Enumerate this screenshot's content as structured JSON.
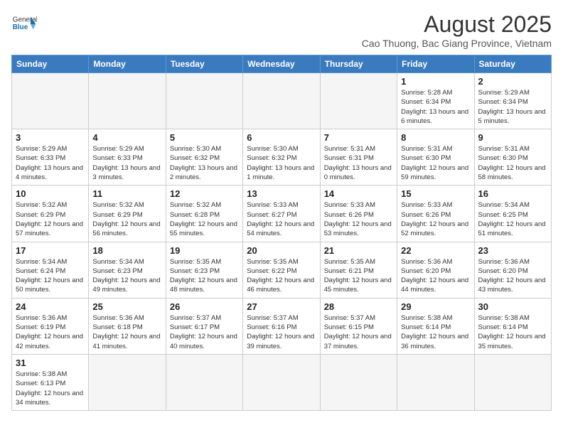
{
  "header": {
    "logo": {
      "general": "General",
      "blue": "Blue"
    },
    "title": "August 2025",
    "subtitle": "Cao Thuong, Bac Giang Province, Vietnam"
  },
  "days_of_week": [
    "Sunday",
    "Monday",
    "Tuesday",
    "Wednesday",
    "Thursday",
    "Friday",
    "Saturday"
  ],
  "weeks": [
    [
      {
        "day": "",
        "info": ""
      },
      {
        "day": "",
        "info": ""
      },
      {
        "day": "",
        "info": ""
      },
      {
        "day": "",
        "info": ""
      },
      {
        "day": "",
        "info": ""
      },
      {
        "day": "1",
        "info": "Sunrise: 5:28 AM\nSunset: 6:34 PM\nDaylight: 13 hours and 6 minutes."
      },
      {
        "day": "2",
        "info": "Sunrise: 5:29 AM\nSunset: 6:34 PM\nDaylight: 13 hours and 5 minutes."
      }
    ],
    [
      {
        "day": "3",
        "info": "Sunrise: 5:29 AM\nSunset: 6:33 PM\nDaylight: 13 hours and 4 minutes."
      },
      {
        "day": "4",
        "info": "Sunrise: 5:29 AM\nSunset: 6:33 PM\nDaylight: 13 hours and 3 minutes."
      },
      {
        "day": "5",
        "info": "Sunrise: 5:30 AM\nSunset: 6:32 PM\nDaylight: 13 hours and 2 minutes."
      },
      {
        "day": "6",
        "info": "Sunrise: 5:30 AM\nSunset: 6:32 PM\nDaylight: 13 hours and 1 minute."
      },
      {
        "day": "7",
        "info": "Sunrise: 5:31 AM\nSunset: 6:31 PM\nDaylight: 13 hours and 0 minutes."
      },
      {
        "day": "8",
        "info": "Sunrise: 5:31 AM\nSunset: 6:30 PM\nDaylight: 12 hours and 59 minutes."
      },
      {
        "day": "9",
        "info": "Sunrise: 5:31 AM\nSunset: 6:30 PM\nDaylight: 12 hours and 58 minutes."
      }
    ],
    [
      {
        "day": "10",
        "info": "Sunrise: 5:32 AM\nSunset: 6:29 PM\nDaylight: 12 hours and 57 minutes."
      },
      {
        "day": "11",
        "info": "Sunrise: 5:32 AM\nSunset: 6:29 PM\nDaylight: 12 hours and 56 minutes."
      },
      {
        "day": "12",
        "info": "Sunrise: 5:32 AM\nSunset: 6:28 PM\nDaylight: 12 hours and 55 minutes."
      },
      {
        "day": "13",
        "info": "Sunrise: 5:33 AM\nSunset: 6:27 PM\nDaylight: 12 hours and 54 minutes."
      },
      {
        "day": "14",
        "info": "Sunrise: 5:33 AM\nSunset: 6:26 PM\nDaylight: 12 hours and 53 minutes."
      },
      {
        "day": "15",
        "info": "Sunrise: 5:33 AM\nSunset: 6:26 PM\nDaylight: 12 hours and 52 minutes."
      },
      {
        "day": "16",
        "info": "Sunrise: 5:34 AM\nSunset: 6:25 PM\nDaylight: 12 hours and 51 minutes."
      }
    ],
    [
      {
        "day": "17",
        "info": "Sunrise: 5:34 AM\nSunset: 6:24 PM\nDaylight: 12 hours and 50 minutes."
      },
      {
        "day": "18",
        "info": "Sunrise: 5:34 AM\nSunset: 6:23 PM\nDaylight: 12 hours and 49 minutes."
      },
      {
        "day": "19",
        "info": "Sunrise: 5:35 AM\nSunset: 6:23 PM\nDaylight: 12 hours and 48 minutes."
      },
      {
        "day": "20",
        "info": "Sunrise: 5:35 AM\nSunset: 6:22 PM\nDaylight: 12 hours and 46 minutes."
      },
      {
        "day": "21",
        "info": "Sunrise: 5:35 AM\nSunset: 6:21 PM\nDaylight: 12 hours and 45 minutes."
      },
      {
        "day": "22",
        "info": "Sunrise: 5:36 AM\nSunset: 6:20 PM\nDaylight: 12 hours and 44 minutes."
      },
      {
        "day": "23",
        "info": "Sunrise: 5:36 AM\nSunset: 6:20 PM\nDaylight: 12 hours and 43 minutes."
      }
    ],
    [
      {
        "day": "24",
        "info": "Sunrise: 5:36 AM\nSunset: 6:19 PM\nDaylight: 12 hours and 42 minutes."
      },
      {
        "day": "25",
        "info": "Sunrise: 5:36 AM\nSunset: 6:18 PM\nDaylight: 12 hours and 41 minutes."
      },
      {
        "day": "26",
        "info": "Sunrise: 5:37 AM\nSunset: 6:17 PM\nDaylight: 12 hours and 40 minutes."
      },
      {
        "day": "27",
        "info": "Sunrise: 5:37 AM\nSunset: 6:16 PM\nDaylight: 12 hours and 39 minutes."
      },
      {
        "day": "28",
        "info": "Sunrise: 5:37 AM\nSunset: 6:15 PM\nDaylight: 12 hours and 37 minutes."
      },
      {
        "day": "29",
        "info": "Sunrise: 5:38 AM\nSunset: 6:14 PM\nDaylight: 12 hours and 36 minutes."
      },
      {
        "day": "30",
        "info": "Sunrise: 5:38 AM\nSunset: 6:14 PM\nDaylight: 12 hours and 35 minutes."
      }
    ],
    [
      {
        "day": "31",
        "info": "Sunrise: 5:38 AM\nSunset: 6:13 PM\nDaylight: 12 hours and 34 minutes."
      },
      {
        "day": "",
        "info": ""
      },
      {
        "day": "",
        "info": ""
      },
      {
        "day": "",
        "info": ""
      },
      {
        "day": "",
        "info": ""
      },
      {
        "day": "",
        "info": ""
      },
      {
        "day": "",
        "info": ""
      }
    ]
  ]
}
